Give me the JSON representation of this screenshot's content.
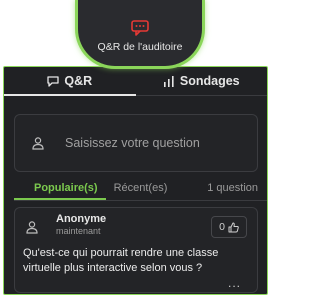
{
  "header": {
    "title": "Q&R de l'auditoire",
    "accent_color": "#8bd65a",
    "icon": "chat-bubble-icon",
    "icon_color": "#e53935"
  },
  "tabs": [
    {
      "label": "Q&R",
      "icon": "comment-icon",
      "active": true
    },
    {
      "label": "Sondages",
      "icon": "bar-chart-icon",
      "active": false
    }
  ],
  "question_input": {
    "placeholder": "Saisissez votre question"
  },
  "filters": {
    "popular": "Populaire(s)",
    "recent": "Récent(es)",
    "count": "1 question",
    "active_color": "#7bc94e"
  },
  "question": {
    "author": "Anonyme",
    "time": "maintenant",
    "likes": "0",
    "text": "Qu'est-ce qui pourrait rendre une classe virtuelle plus interactive selon vous ?",
    "more": "..."
  }
}
